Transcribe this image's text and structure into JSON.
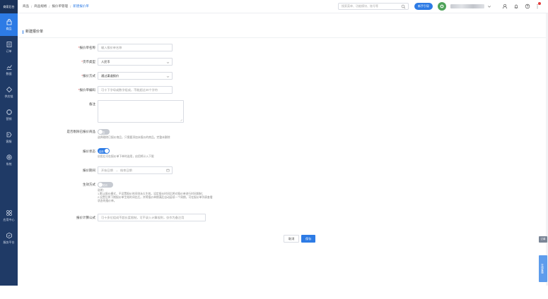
{
  "sidebar": {
    "brand": "商家后台",
    "items": [
      {
        "label": "商品",
        "icon": "bag-icon",
        "active": true
      },
      {
        "label": "订单",
        "icon": "order-icon"
      },
      {
        "label": "数据",
        "icon": "chart-icon"
      },
      {
        "label": "供应链",
        "icon": "supply-icon"
      },
      {
        "label": "营销",
        "icon": "marketing-icon"
      },
      {
        "label": "客服",
        "icon": "service-icon"
      },
      {
        "label": "系统",
        "icon": "settings-icon"
      }
    ],
    "bottom": [
      {
        "label": "应用中心",
        "icon": "apps-icon"
      },
      {
        "label": "服务平台",
        "icon": "platform-icon"
      }
    ]
  },
  "topbar": {
    "breadcrumb": [
      "商品",
      "商品规格",
      "报价单管理",
      "新建报价单"
    ],
    "search_placeholder": "搜索菜单、功能模块、账号等",
    "new_button": "新手引导"
  },
  "page": {
    "title": "新建报价单"
  },
  "form": {
    "name": {
      "label": "报价单名称",
      "required": true,
      "placeholder": "输入报价单名称"
    },
    "currency": {
      "label": "货币类型",
      "required": true,
      "value": "人民币"
    },
    "method": {
      "label": "报价方式",
      "required": true,
      "value": "通过渠道报价"
    },
    "code": {
      "label": "报价单编码",
      "required": true,
      "placeholder": "可十下字母或数字组成，不能超过20个字符"
    },
    "remark": {
      "label": "备注"
    },
    "auto_exclude": {
      "label": "是否剔除已报价商品",
      "state": "否",
      "hint": "选择剔除已报价商品，只需要添加未报价的商品，完整未删除"
    },
    "status": {
      "label": "报价状态",
      "state": "启用",
      "hint": "启用后可在报价单下单时选用，启用将计入下限"
    },
    "period": {
      "label": "报价期间",
      "start_placeholder": "开始日期",
      "separator": "→",
      "end_placeholder": "结束日期"
    },
    "effect": {
      "label": "生效方式",
      "state": "关闭",
      "hint_lines": [
        "说明：",
        "1.默认报价模式，不设置报价时间则永久生效，设定报价时间后将对报价单进行时间限制；",
        "2.设置后将下期报价单生效时间往后，并将报价单期满后自动延续一个周期，可在报价单列表查看",
        "状态的报价单。"
      ]
    },
    "formula": {
      "label": "报价计算公式",
      "placeholder": "可十多位组成不超长度限制，可不录入计算规则，仅作为备注用"
    }
  },
  "actions": {
    "cancel": "取消",
    "save": "保存"
  },
  "side_tabs": {
    "top": "订单",
    "bottom": "在线客服"
  },
  "colors": {
    "sidebar": "#1f3a66",
    "accent": "#2d7be5",
    "required": "#e23b3b"
  }
}
